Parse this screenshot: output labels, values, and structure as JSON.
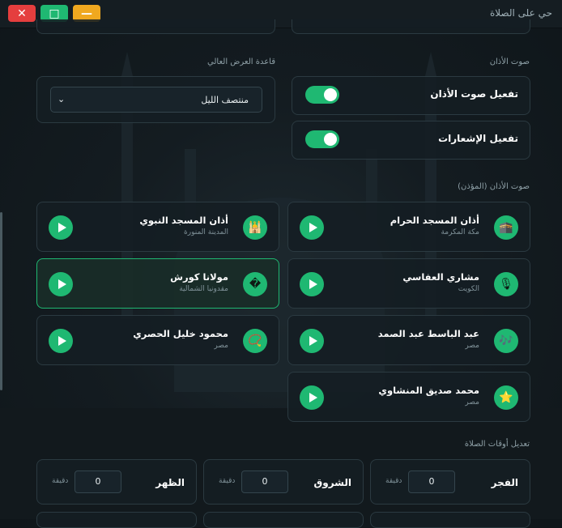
{
  "window": {
    "title": "حي على الصلاة",
    "close": "✕",
    "maximize": "□",
    "minimize": "—"
  },
  "sections": {
    "adhan_sound": "صوت الأذان",
    "high_lat": "قاعدة العرض العالي",
    "muezzin": "صوت الأذان (المؤذن)",
    "adjust": "تعديل أوقات الصلاة"
  },
  "toggles": {
    "adhan": {
      "label": "تفعيل صوت الأذان",
      "on": true
    },
    "notify": {
      "label": "تفعيل الإشعارات",
      "on": true
    }
  },
  "high_lat_select": {
    "value": "منتصف الليل"
  },
  "muezzins": [
    {
      "name": "أذان المسجد الحرام",
      "location": "مكة المكرمة",
      "icon": "kaaba-icon",
      "glyph": "🕋",
      "selected": false
    },
    {
      "name": "أذان المسجد النبوي",
      "location": "المدينة المنورة",
      "icon": "mosque-icon",
      "glyph": "🕌",
      "selected": false
    },
    {
      "name": "مشاري العفاسي",
      "location": "الكويت",
      "icon": "microphone-icon",
      "glyph": "🎙",
      "selected": false
    },
    {
      "name": "مولانا كورش",
      "location": "مقدونيا الشمالية",
      "icon": "unknown-icon",
      "glyph": "�",
      "selected": true
    },
    {
      "name": "عبد الباسط عبد الصمد",
      "location": "مصر",
      "icon": "music-icon",
      "glyph": "🎶",
      "selected": false
    },
    {
      "name": "محمود خليل الحصري",
      "location": "مصر",
      "icon": "prayer-beads-icon",
      "glyph": "📿",
      "selected": false
    },
    {
      "name": "محمد صديق المنشاوي",
      "location": "مصر",
      "icon": "star-icon",
      "glyph": "⭐",
      "selected": false
    }
  ],
  "adjustments": [
    {
      "label": "الفجر",
      "value": "0",
      "unit": "دقيقة"
    },
    {
      "label": "الشروق",
      "value": "0",
      "unit": "دقيقة"
    },
    {
      "label": "الظهر",
      "value": "0",
      "unit": "دقيقة"
    }
  ],
  "colors": {
    "accent": "#1fb872",
    "close": "#e53e3e",
    "minimize": "#f0a81f",
    "card_bg": "#141e23",
    "border": "#2b3a41"
  }
}
